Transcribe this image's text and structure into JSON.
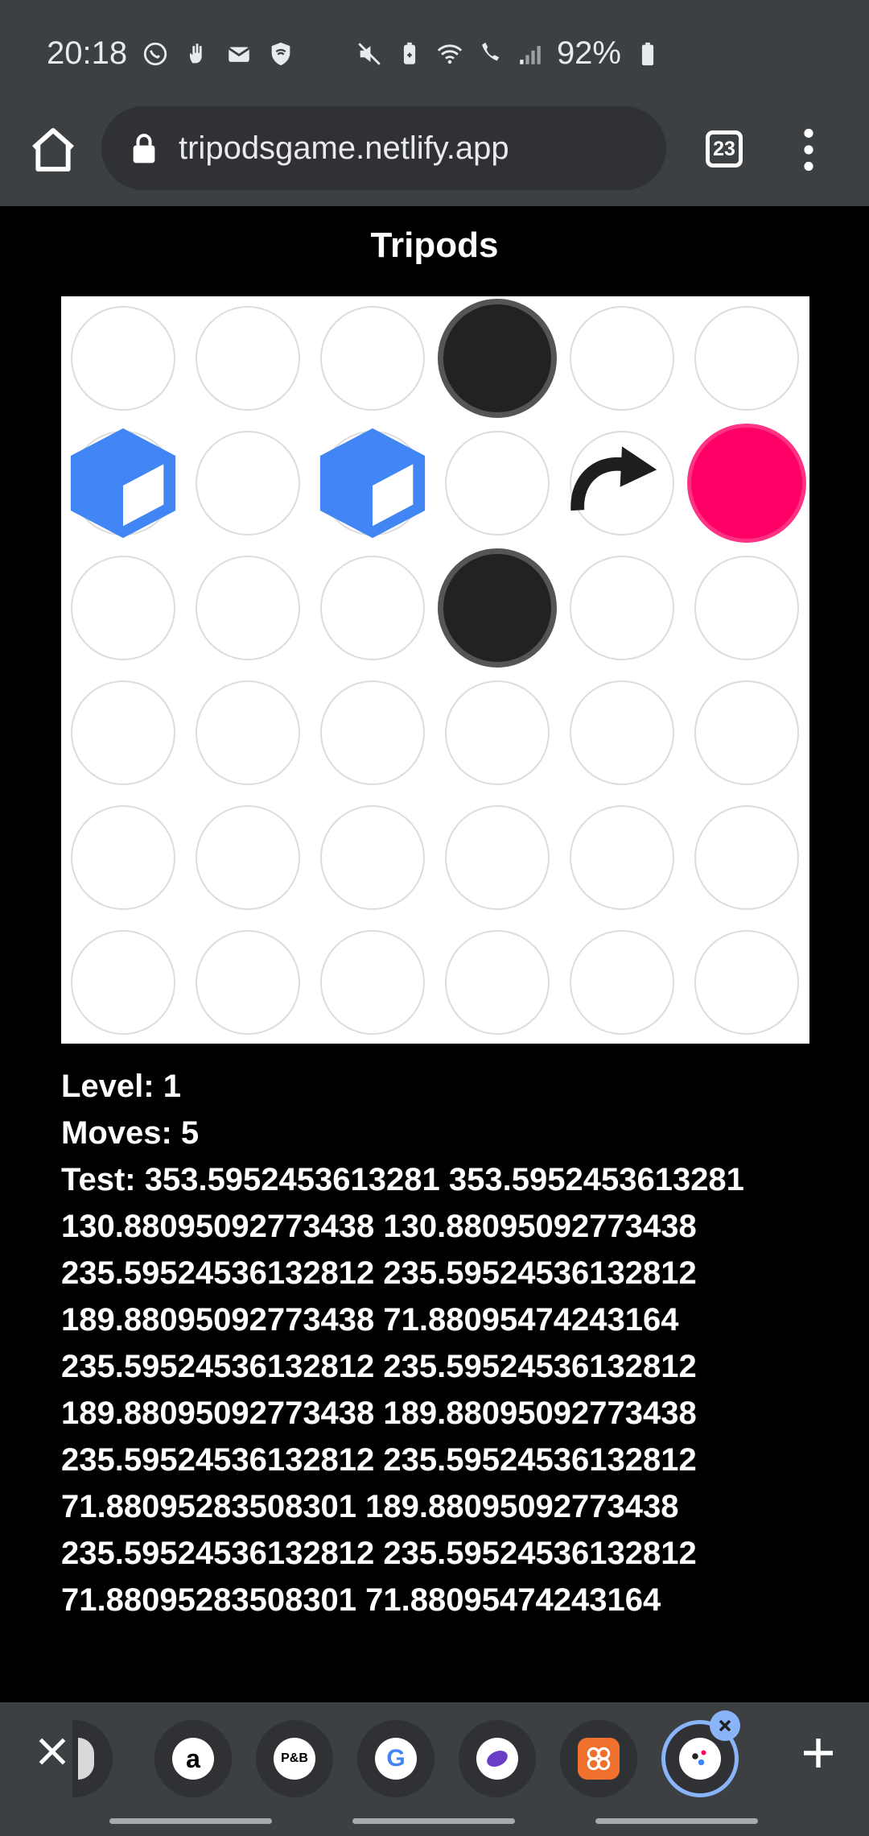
{
  "status_bar": {
    "time": "20:18",
    "battery": "92%"
  },
  "browser": {
    "url": "tripodsgame.netlify.app",
    "tab_count": "23"
  },
  "game": {
    "title": "Tripods",
    "grid": {
      "rows": 6,
      "cols": 6
    },
    "pieces": [
      {
        "type": "black-disc",
        "row": 0,
        "col": 3
      },
      {
        "type": "blue-cube",
        "row": 1,
        "col": 0
      },
      {
        "type": "blue-cube",
        "row": 1,
        "col": 2
      },
      {
        "type": "rotate-arrow",
        "row": 1,
        "col": 4
      },
      {
        "type": "pink-disc",
        "row": 1,
        "col": 5
      },
      {
        "type": "black-disc",
        "row": 2,
        "col": 3
      }
    ],
    "colors": {
      "cube": "#4285f4",
      "pink": "#ff0066",
      "black": "#222222",
      "black_border": "#555555"
    },
    "level_line": "Level: 1",
    "moves_line": "Moves: 5",
    "test_lines": [
      "Test: 353.5952453613281 353.5952453613281",
      "130.88095092773438 130.88095092773438",
      "235.59524536132812 235.59524536132812",
      "189.88095092773438 71.88095474243164",
      "235.59524536132812 235.59524536132812",
      "189.88095092773438 189.88095092773438",
      "235.59524536132812 235.59524536132812",
      "71.88095283508301 189.88095092773438",
      "235.59524536132812 235.59524536132812",
      "71.88095283508301 71.88095474243164"
    ]
  },
  "tab_strip": {
    "tabs": [
      {
        "name": "partial-tab",
        "label": ""
      },
      {
        "name": "amazon-tab",
        "label": "a"
      },
      {
        "name": "pull-and-bear-tab",
        "label": "P&B"
      },
      {
        "name": "google-tab",
        "label": "G"
      },
      {
        "name": "purple-app-tab",
        "label": ""
      },
      {
        "name": "orange-app-tab",
        "label": ""
      },
      {
        "name": "tripods-tab",
        "label": ""
      }
    ]
  }
}
